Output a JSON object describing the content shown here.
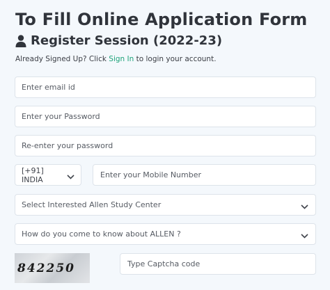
{
  "header": {
    "title": "To Fill Online Application Form",
    "subtitle": "Register Session (2022-23)",
    "subtitle_icon": "user-icon"
  },
  "signin": {
    "prefix": "Already Signed Up? Click ",
    "link": "Sign In",
    "suffix": " to login your account."
  },
  "form": {
    "email_placeholder": "Enter email id",
    "password_placeholder": "Enter your Password",
    "reenter_placeholder": "Re-enter your password",
    "country_code": "[+91] INDIA",
    "mobile_placeholder": "Enter your Mobile Number",
    "study_center_placeholder": "Select Interested Allen Study Center",
    "source_placeholder": "How do you come to know about ALLEN ?",
    "captcha_code": "842250",
    "captcha_placeholder": "Type Captcha code"
  },
  "colors": {
    "link": "#1fa37a",
    "background": "#f4f8fc"
  }
}
